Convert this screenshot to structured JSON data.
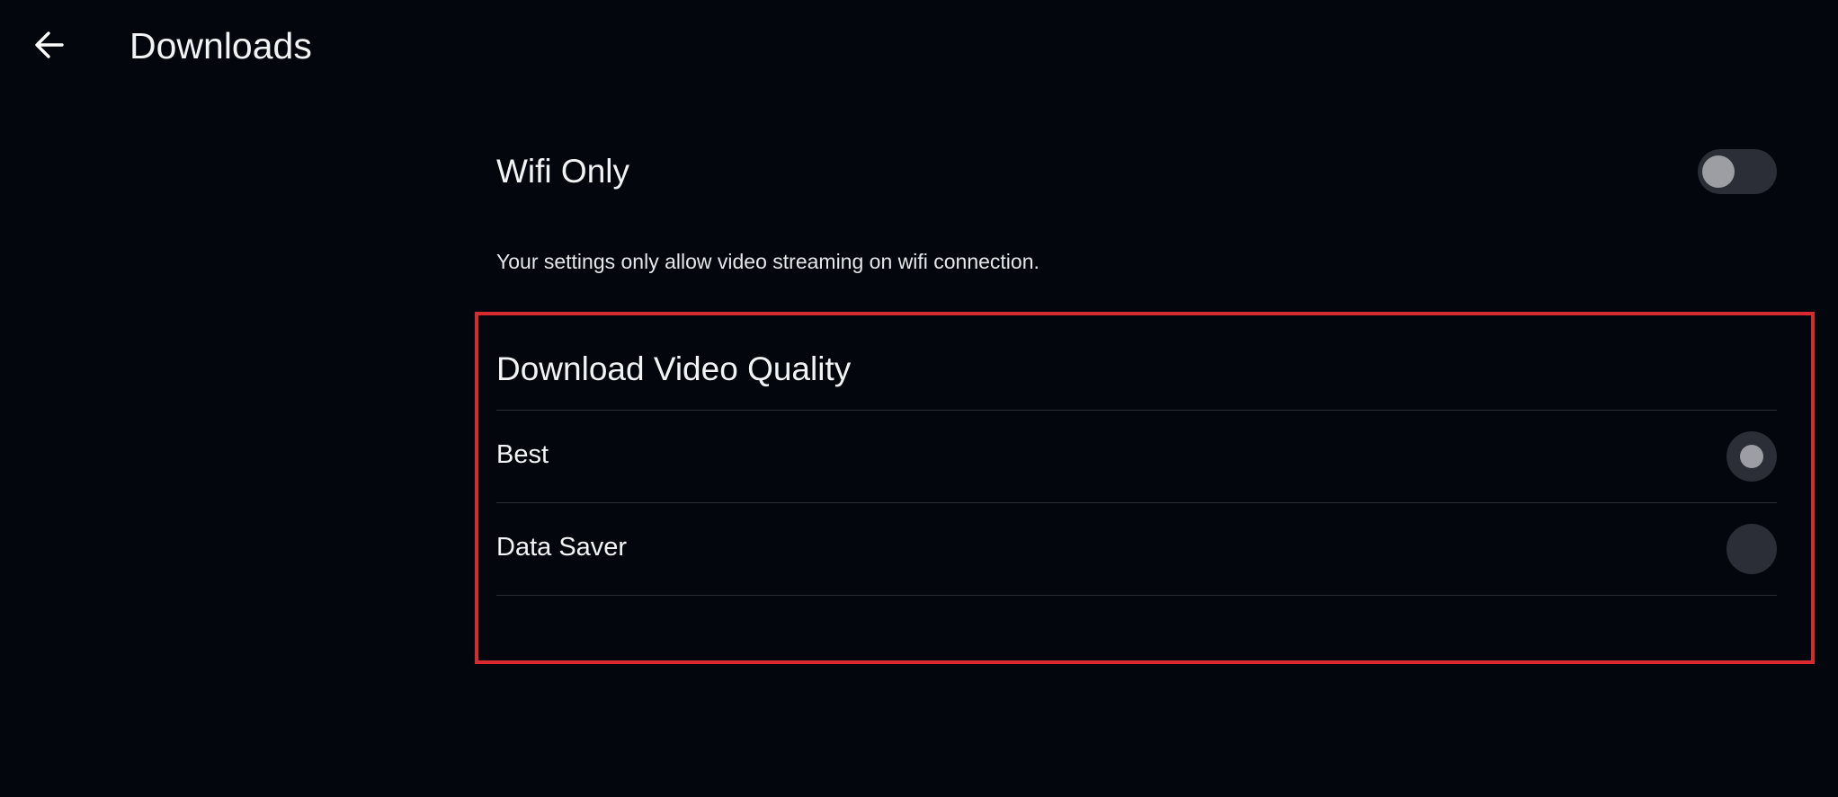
{
  "header": {
    "back_icon": "arrow-left-icon",
    "title": "Downloads"
  },
  "wifi": {
    "label": "Wifi Only",
    "toggle_on": false,
    "description": "Your settings only allow video streaming on wifi connection."
  },
  "quality": {
    "title": "Download Video Quality",
    "options": [
      {
        "label": "Best",
        "selected": true
      },
      {
        "label": "Data Saver",
        "selected": false
      }
    ]
  },
  "colors": {
    "background": "#03060d",
    "highlight_border": "#d52a2f",
    "control_track": "#2b2e36",
    "control_knob": "#9c9ea3"
  }
}
